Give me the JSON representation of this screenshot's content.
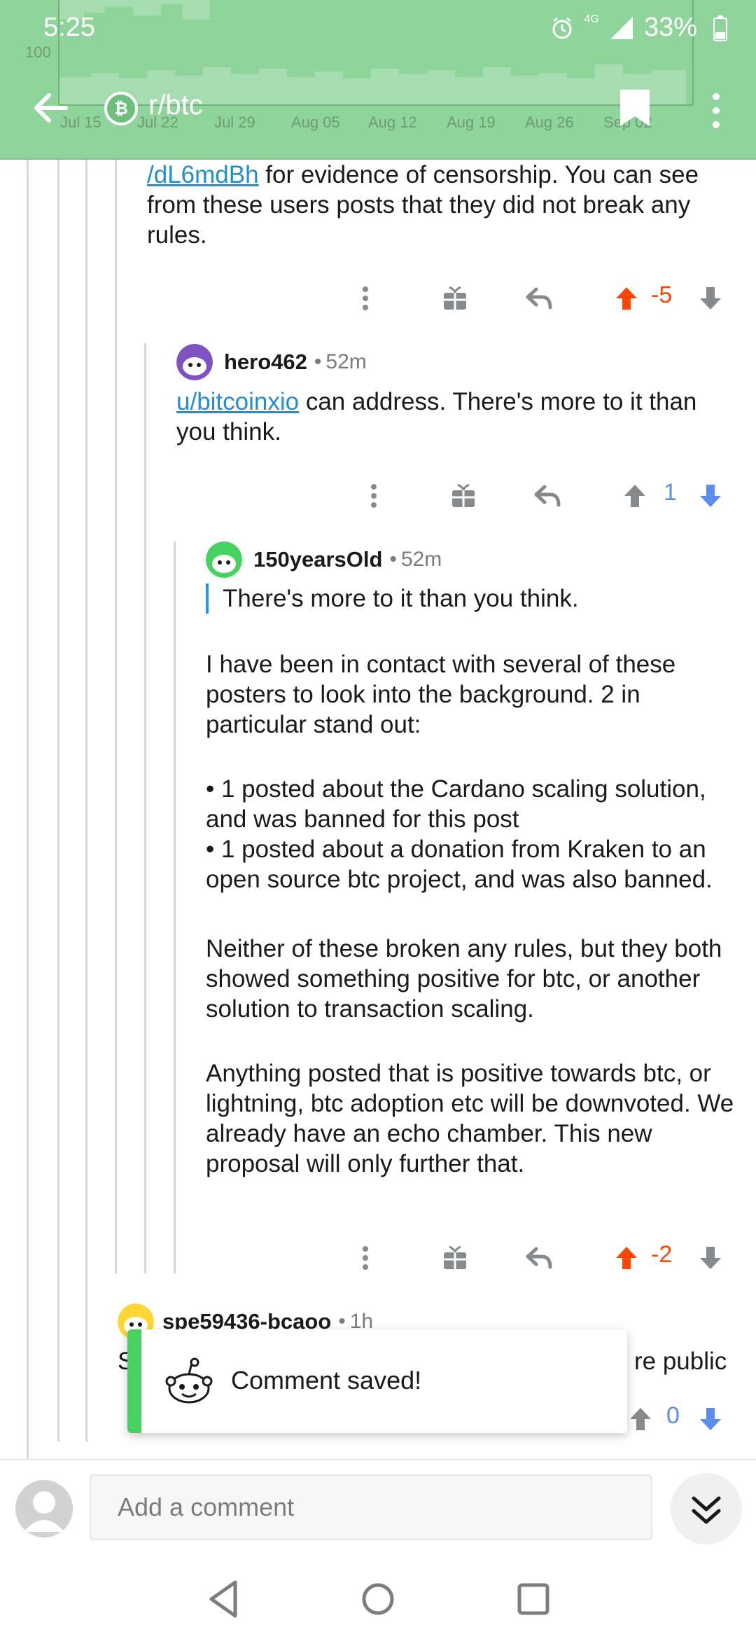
{
  "status_bar": {
    "time": "5:25",
    "network": "4G",
    "battery": "33%"
  },
  "header": {
    "subreddit": "r/btc",
    "chart_labels": {
      "y_ticks": [
        "100"
      ],
      "x_ticks": [
        "Jul 15",
        "Jul 22",
        "Jul 29",
        "Aug 05",
        "Aug 12",
        "Aug 19",
        "Aug 26",
        "Sep 02"
      ]
    },
    "colors": {
      "banner": "#8fd49a",
      "chart_fill": "#a6ddb0"
    }
  },
  "comments": [
    {
      "id": "c1",
      "text_link": "/dL6mdBh",
      "text_rest": " for evidence of censorship. You can see from these users posts that they did not break any rules.",
      "score": "-5",
      "vote": "up"
    },
    {
      "id": "c2",
      "author": "hero462",
      "age": "52m",
      "mention": "u/bitcoinxio",
      "text_rest": "  can address.  There's more to it than you think.",
      "score": "1",
      "vote": "down"
    },
    {
      "id": "c3",
      "author": "150yearsOld",
      "age": "52m",
      "quote": "There's more to it than you think.",
      "para1": "I have been in contact with several of these posters to look into the background. 2 in particular stand out:",
      "bullet1": "• 1 posted about the Cardano scaling solution, and was banned for this post",
      "bullet2": "• 1 posted about a donation from Kraken to an open source btc project, and was also banned.",
      "para2": "Neither of these broken any rules, but they both showed something positive for btc, or another solution to transaction scaling.",
      "para3": "Anything posted that is positive towards btc, or lightning, btc adoption etc will be downvoted. We already have an echo chamber. This new proposal will only further that.",
      "score": "-2",
      "vote": "up"
    },
    {
      "id": "c4",
      "author": "spe59436-bcaoo",
      "age": "1h",
      "text_start": "S",
      "text_end": "re public",
      "score": "0",
      "vote": "down"
    }
  ],
  "toast": {
    "message": "Comment saved!"
  },
  "composer": {
    "placeholder": "Add a comment"
  },
  "icons": {
    "more": "more-vertical-icon",
    "award": "gift-icon",
    "reply": "reply-icon",
    "upvote": "upvote-arrow-icon",
    "downvote": "downvote-arrow-icon"
  },
  "vote_colors": {
    "up": "#ff4500",
    "down": "#5b8def",
    "neutral": "#878a8c"
  }
}
